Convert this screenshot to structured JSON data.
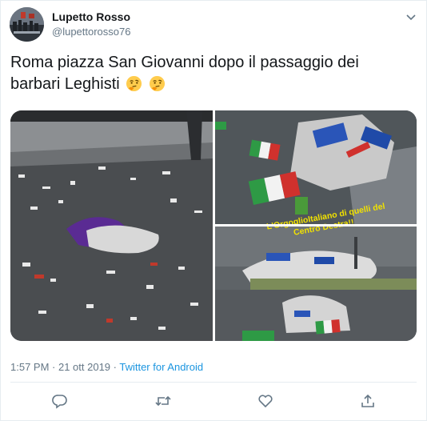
{
  "author": {
    "name": "Lupetto Rosso",
    "handle": "@lupettorosso76"
  },
  "tweet": {
    "text": "Roma piazza San Giovanni dopo il passaggio dei barbari Leghisti",
    "emoji": [
      "thinking-face",
      "thinking-face"
    ]
  },
  "media": {
    "overlay_line1": "L'OrgoglioItaliano di quelli del",
    "overlay_line2": "Centro Destra!!"
  },
  "meta": {
    "time": "1:57 PM · 21 ott 2019 · ",
    "app": "Twitter for Android"
  },
  "actions": [
    "reply-icon",
    "retweet-icon",
    "like-icon",
    "share-icon"
  ],
  "colors": {
    "link": "#1b95e0",
    "secondary": "#657786",
    "border": "#e6ecf0"
  }
}
